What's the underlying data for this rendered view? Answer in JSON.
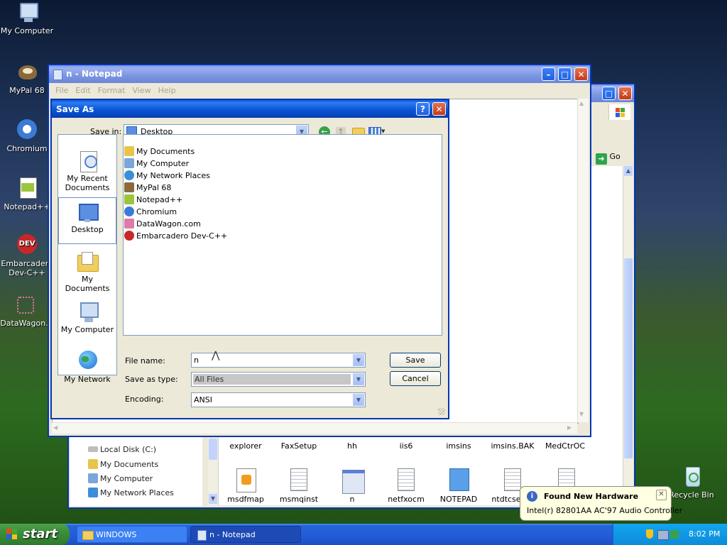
{
  "desktop": {
    "icons": [
      {
        "label": "My Computer",
        "icon": "computer-icon"
      },
      {
        "label": "MyPal 68",
        "icon": "mypal-icon"
      },
      {
        "label": "Chromium",
        "icon": "chromium-icon"
      },
      {
        "label": "Notepad++",
        "icon": "notepadpp-icon"
      },
      {
        "label": "Embarcadero Dev-C++",
        "icon": "devcpp-icon"
      },
      {
        "label": "DataWagon.",
        "icon": "datawagon-icon"
      }
    ],
    "recycle_bin": "Recycle Bin"
  },
  "explorer": {
    "go_label": "Go",
    "left_items": [
      "Local Disk (C:)",
      "My Documents",
      "My Computer",
      "My Network Places"
    ],
    "file_row1": [
      "explorer",
      "FaxSetup",
      "hh",
      "iis6",
      "imsins",
      "imsins.BAK",
      "MedCtrOC"
    ],
    "file_row2": [
      "msdfmap",
      "msmqinst",
      "n",
      "netfxocm",
      "NOTEPAD",
      "ntdtcse",
      ""
    ]
  },
  "notepad": {
    "title": "n - Notepad",
    "menu": [
      "File",
      "Edit",
      "Format",
      "View",
      "Help"
    ]
  },
  "saveas": {
    "title": "Save As",
    "save_in_label": "Save in:",
    "save_in_value": "Desktop",
    "places": [
      "My Recent Documents",
      "Desktop",
      "My Documents",
      "My Computer",
      "My Network"
    ],
    "files": [
      {
        "name": "My Documents",
        "icon": "folder-docs-icon",
        "color": "#e8c54a"
      },
      {
        "name": "My Computer",
        "icon": "computer-icon",
        "color": "#7aa6d8"
      },
      {
        "name": "My Network Places",
        "icon": "network-icon",
        "color": "#3d8ed8"
      },
      {
        "name": "MyPal 68",
        "icon": "mypal-icon",
        "color": "#8a6a3a"
      },
      {
        "name": "Notepad++",
        "icon": "notepadpp-icon",
        "color": "#9bc53d"
      },
      {
        "name": "Chromium",
        "icon": "chromium-icon",
        "color": "#3b7bd6"
      },
      {
        "name": "DataWagon.com",
        "icon": "datawagon-icon",
        "color": "#e07aa8"
      },
      {
        "name": "Embarcadero Dev-C++",
        "icon": "devcpp-icon",
        "color": "#c62828"
      }
    ],
    "file_name_label": "File name:",
    "file_name_value": "n",
    "save_type_label": "Save as type:",
    "save_type_value": "All Files",
    "encoding_label": "Encoding:",
    "encoding_value": "ANSI",
    "save_button": "Save",
    "cancel_button": "Cancel"
  },
  "balloon": {
    "title": "Found New Hardware",
    "body": "Intel(r) 82801AA AC'97 Audio Controller"
  },
  "taskbar": {
    "start_label": "start",
    "tasks": [
      "WINDOWS",
      "n - Notepad"
    ],
    "clock": "8:02 PM"
  }
}
